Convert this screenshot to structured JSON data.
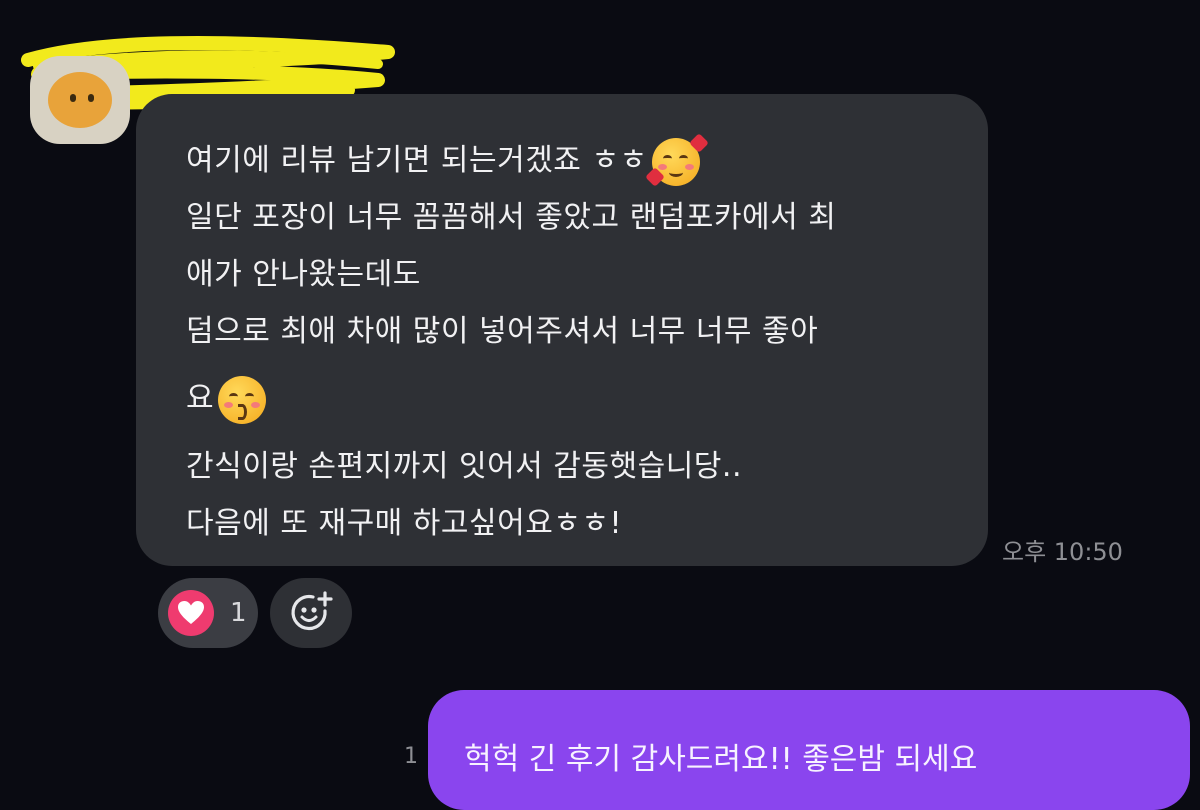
{
  "chat": {
    "incoming": {
      "lines": [
        "여기에 리뷰 남기면 되는거겠죠 ㅎㅎ",
        "일단 포장이 너무 꼼꼼해서 좋았고 랜덤포카에서 최",
        "애가 안나왔는데도",
        "덤으로 최애 차애 많이 넣어주셔서 너무 너무 좋아",
        "요",
        "간식이랑 손편지까지 잇어서 감동햇습니당..",
        "다음에 또 재구매 하고싶어요ㅎㅎ!"
      ],
      "emojis": [
        "smiling-face-with-hearts",
        "kissing-face-with-smiling-eyes"
      ],
      "timestamp": "오후 10:50",
      "reaction": {
        "icon": "heart-icon",
        "count": "1"
      }
    },
    "outgoing": {
      "read_count": "1",
      "text": "헉헉 긴 후기 감사드려요!! 좋은밤 되세요"
    }
  },
  "colors": {
    "background": "#0a0b12",
    "incoming_bubble": "#2e3035",
    "outgoing_bubble": "#8a45ee",
    "reaction_heart": "#ef3b6f",
    "redaction_marker": "#f2ea1c"
  }
}
